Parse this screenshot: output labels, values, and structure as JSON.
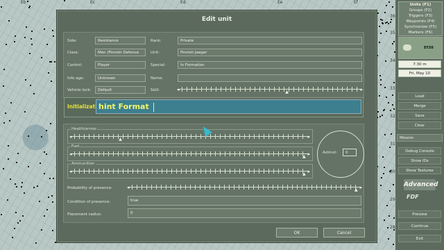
{
  "map": {
    "top_coords": [
      "Eb",
      "Ec",
      "Ed",
      "Ee",
      "Ef"
    ],
    "right_coords": [
      "36",
      "35",
      "34",
      "33",
      "32",
      "31",
      "30",
      "29",
      "28"
    ]
  },
  "dialog": {
    "title": "Edit unit",
    "fields": {
      "side": {
        "label": "Side:",
        "value": "Resistance"
      },
      "class": {
        "label": "Class:",
        "value": "Men (Finnish Defence"
      },
      "control": {
        "label": "Control:",
        "value": "Player"
      },
      "info_age": {
        "label": "Info age:",
        "value": "Unknown"
      },
      "vehicle_lock": {
        "label": "Vehicle lock:",
        "value": "Default"
      },
      "rank": {
        "label": "Rank:",
        "value": "Private"
      },
      "unit": {
        "label": "Unit:",
        "value": "Finnish Jaeger"
      },
      "special": {
        "label": "Special:",
        "value": "In Formation"
      },
      "name": {
        "label": "Name:",
        "value": ""
      },
      "skill": {
        "label": "Skill:",
        "value_fraction": 0.6
      }
    },
    "initialization": {
      "label": "Initialization:",
      "value": "hint Format"
    },
    "sliders": {
      "health": {
        "label": "Health/armor",
        "value_fraction": 0.2
      },
      "fuel": {
        "label": "Fuel",
        "value_fraction": 1.0
      },
      "ammunition": {
        "label": "Ammunition",
        "value_fraction": 1.0
      },
      "probability": {
        "label": "Probability of presence:",
        "value_fraction": 1.0
      }
    },
    "azimut": {
      "label": "Azimut:",
      "value": "0"
    },
    "condition": {
      "label": "Condition of presence:",
      "value": "true"
    },
    "placement": {
      "label": "Placement radius:",
      "value": "0"
    },
    "ok_label": "OK",
    "cancel_label": "Cancel"
  },
  "right_panel": {
    "tabs": [
      "Units (F1)",
      "Groups (F2)",
      "Triggers (F3)",
      "Waypoints (F4)",
      "Synchronize (F5)",
      "Markers (F6)"
    ],
    "map_label": "Ef38",
    "time": "7:30 m",
    "date": "Fri, May 10",
    "buttons": [
      "Load",
      "Merge",
      "Save",
      "Clear"
    ],
    "mission_label": "Mission",
    "tools": [
      "Debug Console",
      "Show IDs",
      "Show Textures"
    ],
    "advanced_label": "Advanced",
    "logo_text": "FDF",
    "bottom_buttons": [
      "Preview",
      "Continue",
      "Exit"
    ]
  }
}
